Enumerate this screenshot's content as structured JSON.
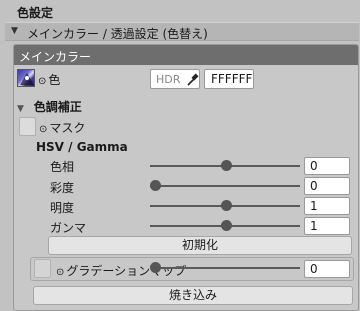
{
  "section_title": "色設定",
  "foldout": {
    "label": "メインカラー / 透過設定 (色替え)"
  },
  "panel": {
    "header": "メインカラー",
    "color_row": {
      "bullet": "⊙",
      "label": "色",
      "hdr_label": "HDR",
      "hex_value": "FFFFFF"
    },
    "color_correction": {
      "title": "色調補正",
      "mask": {
        "bullet": "⊙",
        "label": "マスク"
      },
      "hsv_title": "HSV / Gamma",
      "sliders": [
        {
          "label": "色相",
          "value": "0",
          "level": 0.5
        },
        {
          "label": "彩度",
          "value": "0",
          "level": 0.0
        },
        {
          "label": "明度",
          "value": "1",
          "level": 0.5
        },
        {
          "label": "ガンマ",
          "value": "1",
          "level": 0.5
        }
      ],
      "reset_button": "初期化"
    },
    "gradation_map": {
      "bullet": "⊙",
      "label": "グラデーションマップ",
      "value": "0",
      "level": 0.0
    },
    "bake_button": "焼き込み"
  }
}
